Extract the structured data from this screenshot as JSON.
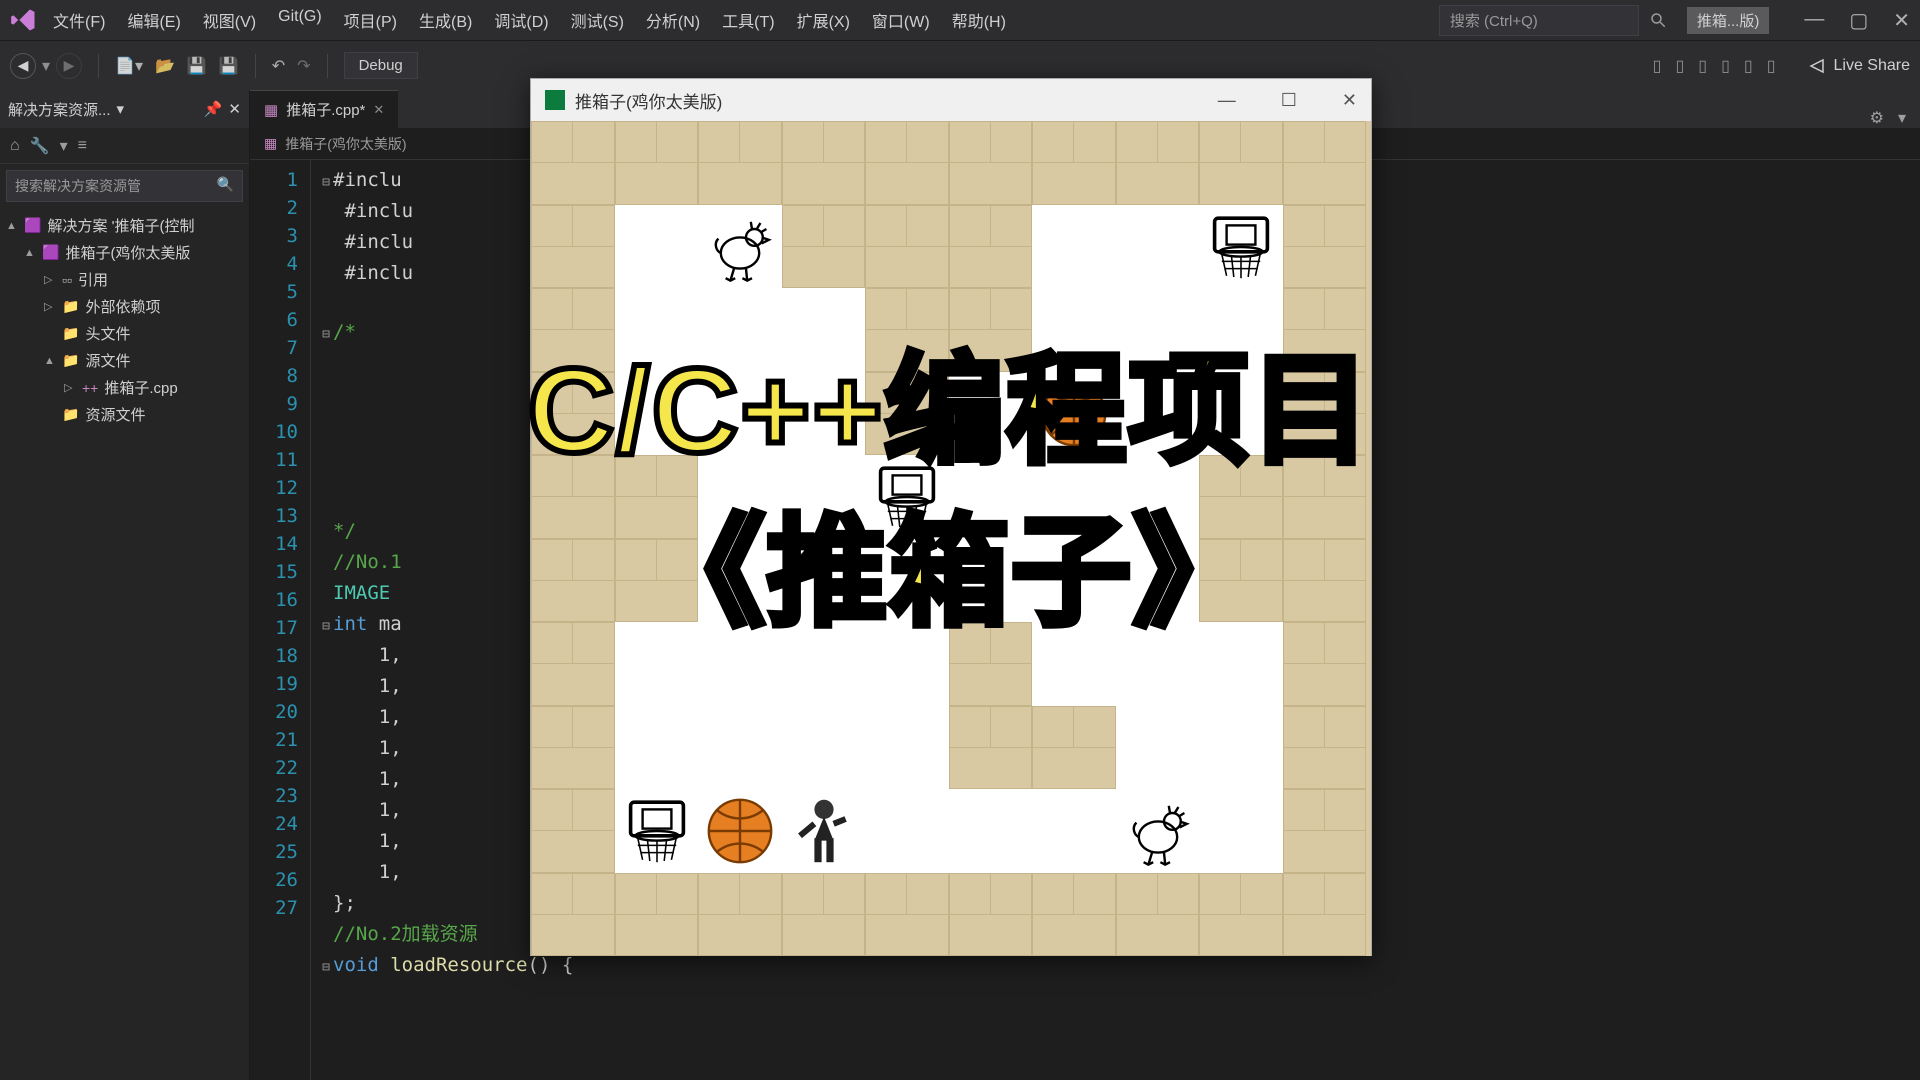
{
  "menu": [
    "文件(F)",
    "编辑(E)",
    "视图(V)",
    "Git(G)",
    "项目(P)",
    "生成(B)",
    "调试(D)",
    "测试(S)",
    "分析(N)",
    "工具(T)",
    "扩展(X)",
    "窗口(W)",
    "帮助(H)"
  ],
  "search_placeholder": "搜索 (Ctrl+Q)",
  "badge": "推箱...版)",
  "toolbar": {
    "config": "Debug",
    "liveshare": "Live Share"
  },
  "sidebar": {
    "title": "解决方案资源...",
    "search": "搜索解决方案资源管",
    "items": [
      {
        "label": "解决方案 '推箱子(控制",
        "icon": "sln",
        "indent": 0,
        "arrow": "▲"
      },
      {
        "label": "推箱子(鸡你太美版",
        "icon": "proj",
        "indent": 1,
        "arrow": "▲"
      },
      {
        "label": "引用",
        "icon": "ref",
        "indent": 2,
        "arrow": "▷"
      },
      {
        "label": "外部依赖项",
        "icon": "folder",
        "indent": 2,
        "arrow": "▷"
      },
      {
        "label": "头文件",
        "icon": "folder",
        "indent": 2,
        "arrow": ""
      },
      {
        "label": "源文件",
        "icon": "folder",
        "indent": 2,
        "arrow": "▲"
      },
      {
        "label": "推箱子.cpp",
        "icon": "cpp",
        "indent": 3,
        "arrow": "▷"
      },
      {
        "label": "资源文件",
        "icon": "folder",
        "indent": 2,
        "arrow": ""
      }
    ]
  },
  "tab": {
    "label": "推箱子.cpp*",
    "breadcrumb": "推箱子(鸡你太美版)"
  },
  "code": {
    "lines": [
      {
        "n": 1,
        "html": "<span class='fold'>⊟</span>#inclu"
      },
      {
        "n": 2,
        "html": "<span class='fold'> </span> #inclu"
      },
      {
        "n": 3,
        "html": "<span class='fold'> </span> #inclu"
      },
      {
        "n": 4,
        "html": "<span class='fold'> </span> #inclu"
      },
      {
        "n": 5,
        "html": ""
      },
      {
        "n": 6,
        "html": "<span class='fold'>⊟</span><span class='cm'>/*</span>"
      },
      {
        "n": 7,
        "html": ""
      },
      {
        "n": 8,
        "html": ""
      },
      {
        "n": 9,
        "html": ""
      },
      {
        "n": 10,
        "html": ""
      },
      {
        "n": 11,
        "html": ""
      },
      {
        "n": 12,
        "html": ""
      },
      {
        "n": 13,
        "html": "<span class='fold'> </span><span class='cm'>*/</span>"
      },
      {
        "n": 14,
        "html": "<span class='fold'> </span><span class='cm'>//No.1</span>"
      },
      {
        "n": 15,
        "html": "<span class='fold'> </span><span class='ty'>IMAGE</span>"
      },
      {
        "n": 16,
        "html": "<span class='fold'>⊟</span><span class='kw'>int</span> ma"
      },
      {
        "n": 17,
        "html": "<span class='fold'> </span>    1,"
      },
      {
        "n": 18,
        "html": "<span class='fold'> </span>    1,"
      },
      {
        "n": 19,
        "html": "<span class='fold'> </span>    1,"
      },
      {
        "n": 20,
        "html": "<span class='fold'> </span>    1,"
      },
      {
        "n": 21,
        "html": "<span class='fold'> </span>    1,"
      },
      {
        "n": 22,
        "html": "<span class='fold'> </span>    1,"
      },
      {
        "n": 23,
        "html": "<span class='fold'> </span>    1,"
      },
      {
        "n": 24,
        "html": "<span class='fold'> </span>    1,"
      },
      {
        "n": 25,
        "html": "<span class='fold'> </span>};"
      },
      {
        "n": 26,
        "html": "<span class='fold'> </span><span class='cm'>//No.2加载资源</span>"
      },
      {
        "n": 27,
        "html": "<span class='fold'>⊟</span><span class='kw'>void</span> <span class='fn'>loadResource</span>() {"
      }
    ]
  },
  "game": {
    "title": "推箱子(鸡你太美版)",
    "grid_size": 10,
    "map": [
      [
        1,
        1,
        1,
        1,
        1,
        1,
        1,
        1,
        1,
        1
      ],
      [
        1,
        0,
        0,
        1,
        1,
        1,
        0,
        0,
        0,
        1
      ],
      [
        1,
        0,
        0,
        0,
        1,
        1,
        0,
        0,
        0,
        1
      ],
      [
        1,
        0,
        0,
        0,
        1,
        0,
        0,
        0,
        0,
        1
      ],
      [
        1,
        1,
        0,
        0,
        0,
        0,
        0,
        0,
        1,
        1
      ],
      [
        1,
        1,
        0,
        0,
        0,
        0,
        0,
        0,
        1,
        1
      ],
      [
        1,
        0,
        0,
        0,
        0,
        1,
        0,
        0,
        0,
        1
      ],
      [
        1,
        0,
        0,
        0,
        0,
        1,
        1,
        0,
        0,
        1
      ],
      [
        1,
        0,
        0,
        0,
        0,
        0,
        0,
        0,
        0,
        1
      ],
      [
        1,
        1,
        1,
        1,
        1,
        1,
        1,
        1,
        1,
        1
      ]
    ],
    "sprites": [
      {
        "type": "rooster",
        "r": 1,
        "c": 2
      },
      {
        "type": "hoop",
        "r": 1,
        "c": 8
      },
      {
        "type": "ball",
        "r": 3,
        "c": 6
      },
      {
        "type": "hoop",
        "r": 4,
        "c": 4
      },
      {
        "type": "hoop",
        "r": 8,
        "c": 1
      },
      {
        "type": "ball",
        "r": 8,
        "c": 2
      },
      {
        "type": "player",
        "r": 8,
        "c": 3
      },
      {
        "type": "rooster",
        "r": 8,
        "c": 7
      }
    ]
  },
  "overlay": {
    "line1": "C/C++编程项目",
    "line2": "《推箱子》"
  }
}
